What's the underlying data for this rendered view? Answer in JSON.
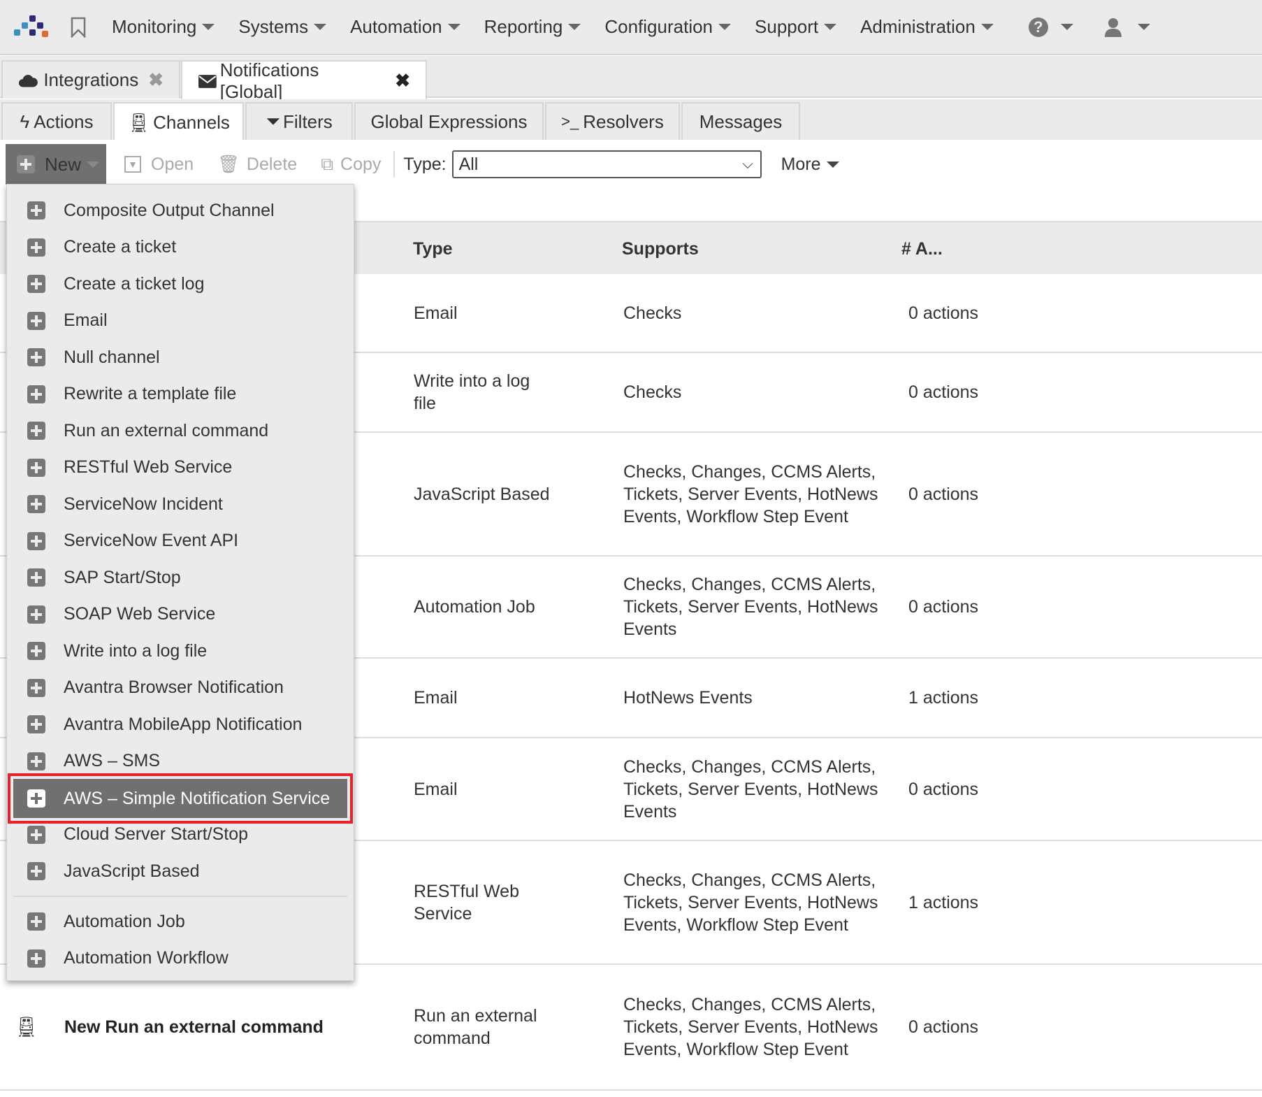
{
  "nav": {
    "items": [
      "Monitoring",
      "Systems",
      "Automation",
      "Reporting",
      "Configuration",
      "Support",
      "Administration"
    ]
  },
  "tabs": [
    {
      "label": "Integrations",
      "icon": "cloud-icon"
    },
    {
      "label": "Notifications [Global]",
      "icon": "envelope-icon"
    }
  ],
  "subtabs": [
    "Actions",
    "Channels",
    "Filters",
    "Global Expressions",
    "Resolvers",
    "Messages"
  ],
  "toolbar": {
    "new": "New",
    "open": "Open",
    "delete": "Delete",
    "copy": "Copy",
    "type_label": "Type:",
    "type_value": "All",
    "more": "More"
  },
  "table": {
    "headers": [
      "Type",
      "Supports",
      "# A..."
    ],
    "rows": [
      {
        "name": "",
        "type": "Email",
        "supports": "Checks",
        "actions": "0 actions"
      },
      {
        "name": "",
        "type": "Write into a log file",
        "supports": "Checks",
        "actions": "0 actions"
      },
      {
        "name": "",
        "type": "JavaScript Based",
        "supports": "Checks, Changes, CCMS Alerts, Tickets, Server Events, HotNews Events, Workflow Step Event",
        "actions": "0 actions"
      },
      {
        "name": "",
        "type": "Automation Job",
        "supports": "Checks, Changes, CCMS Alerts, Tickets, Server Events, HotNews Events",
        "actions": "0 actions"
      },
      {
        "name": "",
        "type": "Email",
        "supports": "HotNews Events",
        "actions": "1 actions"
      },
      {
        "name": "",
        "type": "Email",
        "supports": "Checks, Changes, CCMS Alerts, Tickets, Server Events, HotNews Events",
        "actions": "0 actions"
      },
      {
        "name": "",
        "type": "RESTful Web Service",
        "supports": "Checks, Changes, CCMS Alerts, Tickets, Server Events, HotNews Events, Workflow Step Event",
        "actions": "1 actions"
      },
      {
        "name": "New Run an external command",
        "type": "Run an external command",
        "supports": "Checks, Changes, CCMS Alerts, Tickets, Server Events, HotNews Events, Workflow Step Event",
        "actions": "0 actions"
      }
    ]
  },
  "menu": {
    "items": [
      "Composite Output Channel",
      "Create a ticket",
      "Create a ticket log",
      "Email",
      "Null channel",
      "Rewrite a template file",
      "Run an external command",
      "RESTful Web Service",
      "ServiceNow Incident",
      "ServiceNow Event API",
      "SAP Start/Stop",
      "SOAP Web Service",
      "Write into a log file",
      "Avantra Browser Notification",
      "Avantra MobileApp Notification",
      "AWS – SMS",
      "AWS – Simple Notification Service",
      "Cloud Server Start/Stop",
      "JavaScript Based"
    ],
    "items2": [
      "Automation Job",
      "Automation Workflow"
    ],
    "selected": "AWS – Simple Notification Service"
  },
  "colors": {
    "highlight": "#e8212b",
    "selected_bg": "#707070"
  }
}
